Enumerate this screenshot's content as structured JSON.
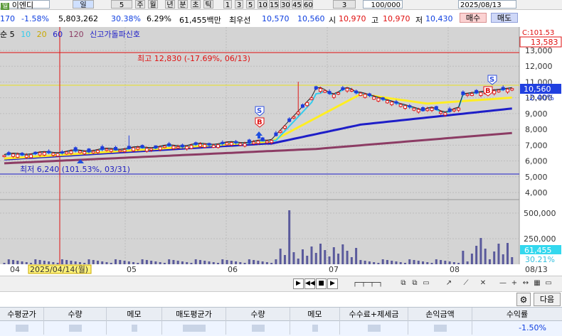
{
  "topbar": {
    "stock_name": "이엔디",
    "code_badge": "일",
    "interval_select": "일",
    "interval_num": "5",
    "period_buttons": [
      "주",
      "월",
      "년",
      "분",
      "초",
      "틱"
    ],
    "tick_buttons": [
      "1",
      "3",
      "5",
      "10",
      "15",
      "30",
      "45",
      "60"
    ],
    "count_select": "3",
    "count_input": "100/000",
    "date_input": "2025/08/13",
    "change_value": "170",
    "change_pct": "-1.58%",
    "volume": "5,803,262",
    "volume_ratio": "30.38%",
    "turnover": "6.29%",
    "amount": "61,455백만",
    "ask_label": "최우선",
    "ask1": "10,570",
    "bid1": "10,560",
    "open_label": "시",
    "open": "10,970",
    "high_label": "고",
    "high": "10,970",
    "low_label": "저",
    "low": "10,430",
    "buy_label": "매수",
    "sell_label": "매도"
  },
  "legend": {
    "prefix": "순 5",
    "ma10": "10",
    "ma20": "20",
    "ma60": "60",
    "ma120": "120",
    "signal": "신고가돌파신호"
  },
  "colors": {
    "bg": "#d4d4d4",
    "up": "#e01818",
    "down": "#1e3cdc",
    "ma5": "#222222",
    "ma10": "#33ccee",
    "ma20": "#ffee22",
    "ma60": "#1e1ec8",
    "ma120": "#8c3c64",
    "volume": "#5a5a9c"
  },
  "annotations": {
    "high_label": "최고 12,830 (-17.69%, 06/13)",
    "low_label": "최저 6,240 (101.53%, 03/31)",
    "top_right_price": "C:101.53",
    "price_tag_high": "13,583",
    "price_tag_current": "10,560",
    "price_tag_change": "-2.40%",
    "volume_tag": "61,455",
    "volume_tag_pct": "30.21%"
  },
  "chart_data": {
    "type": "candlestick",
    "price_axis": [
      "13,000",
      "12,000",
      "11,000",
      "10,000",
      "9,000",
      "8,000",
      "7,000",
      "6,000",
      "5,000",
      "4,000"
    ],
    "volume_axis": [
      "500,000",
      "250,000"
    ],
    "x_labels": [
      "04",
      "2025/04/14(월)",
      "05",
      "06",
      "07",
      "08",
      "08/13"
    ],
    "ylim": [
      4000,
      13500
    ]
  },
  "toolbar": {
    "next_label": "다음"
  },
  "table": {
    "headers": [
      "수평균가",
      "수량",
      "메모",
      "매도평균가",
      "수량",
      "메모",
      "수수료+제세금",
      "손익금액",
      "수익률"
    ],
    "row": [
      "",
      "",
      "",
      "",
      "",
      "",
      "",
      "",
      "-1.50%"
    ]
  }
}
